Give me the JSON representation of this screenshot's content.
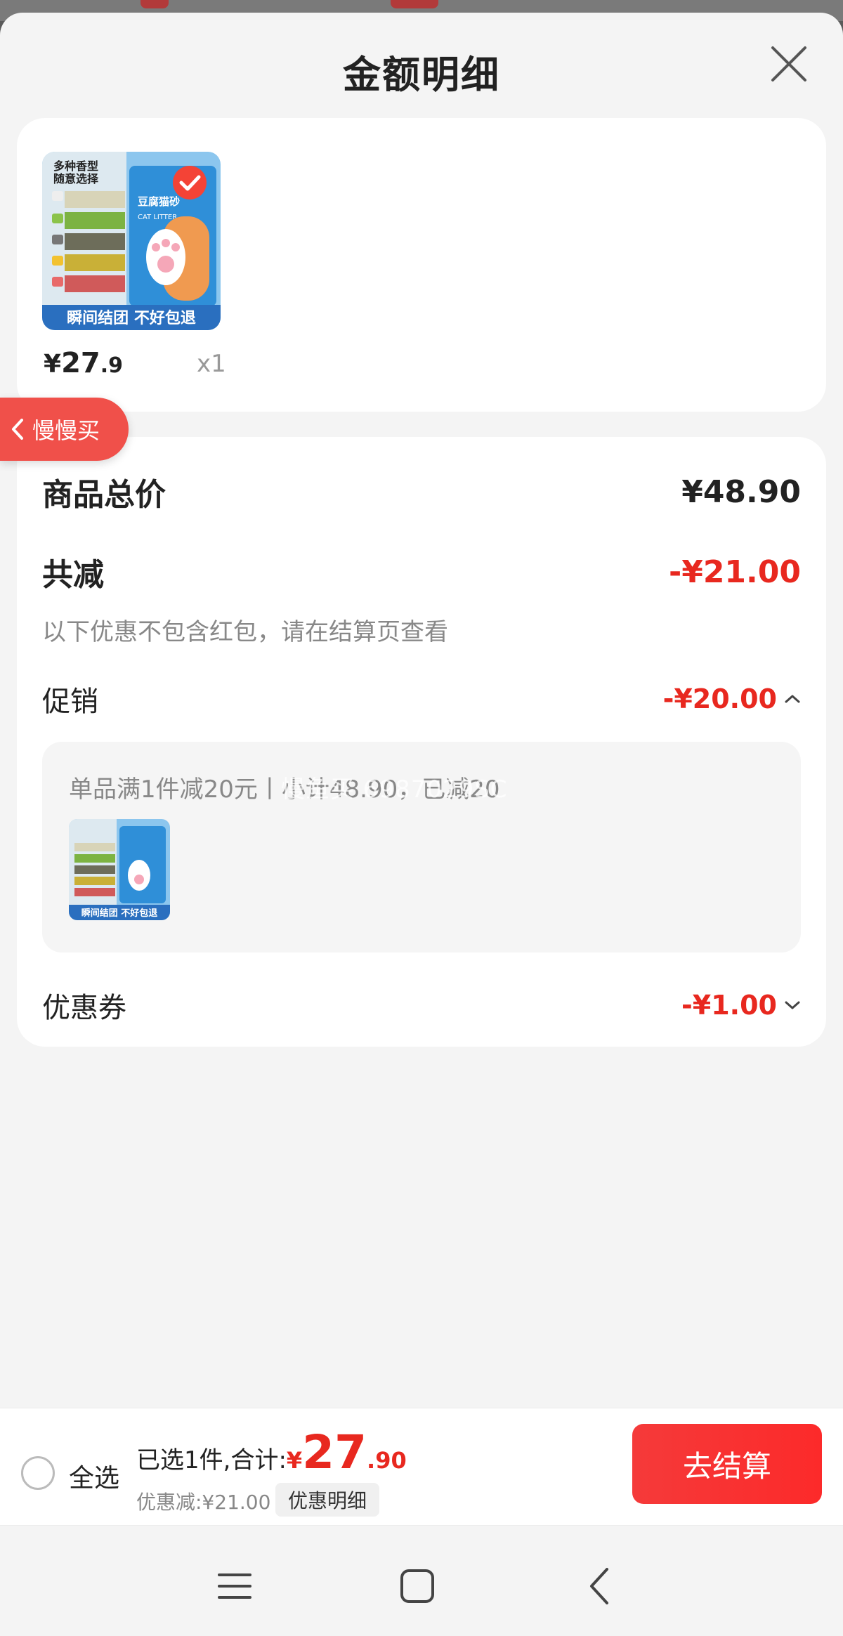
{
  "sheet": {
    "title": "金额明细"
  },
  "product": {
    "price_symbol": "¥",
    "price_int": "27",
    "price_dec": ".9",
    "quantity": "x1",
    "thumb_tagline": "多种香型 随意选择",
    "thumb_banner": "瞬间结团 不好包退",
    "thumb_brand": "CAT LITTER"
  },
  "slow_buy": {
    "label": "慢慢买"
  },
  "details": {
    "total_label": "商品总价",
    "total_value": "¥48.90",
    "reduce_label": "共减",
    "reduce_value": "-¥21.00",
    "reduce_note": "以下优惠不包含红包，请在结算页查看",
    "promo_label": "促销",
    "promo_value": "-¥20.00",
    "promo_desc": "单品满1件减20元丨小计48.90，已减20",
    "coupon_label": "优惠券",
    "coupon_value": "-¥1.00"
  },
  "watermark": "慢鱼买 6987029SC",
  "bottom": {
    "select_all": "全选",
    "selected_text": "已选1件,合计:",
    "currency": "¥",
    "total_int": "27",
    "total_dec": ".90",
    "discount_text": "优惠减:¥21.00",
    "detail_button": "优惠明细",
    "checkout_button": "去结算"
  },
  "colors": {
    "accent_red": "#e8281f",
    "badge_red": "#f0504a"
  }
}
